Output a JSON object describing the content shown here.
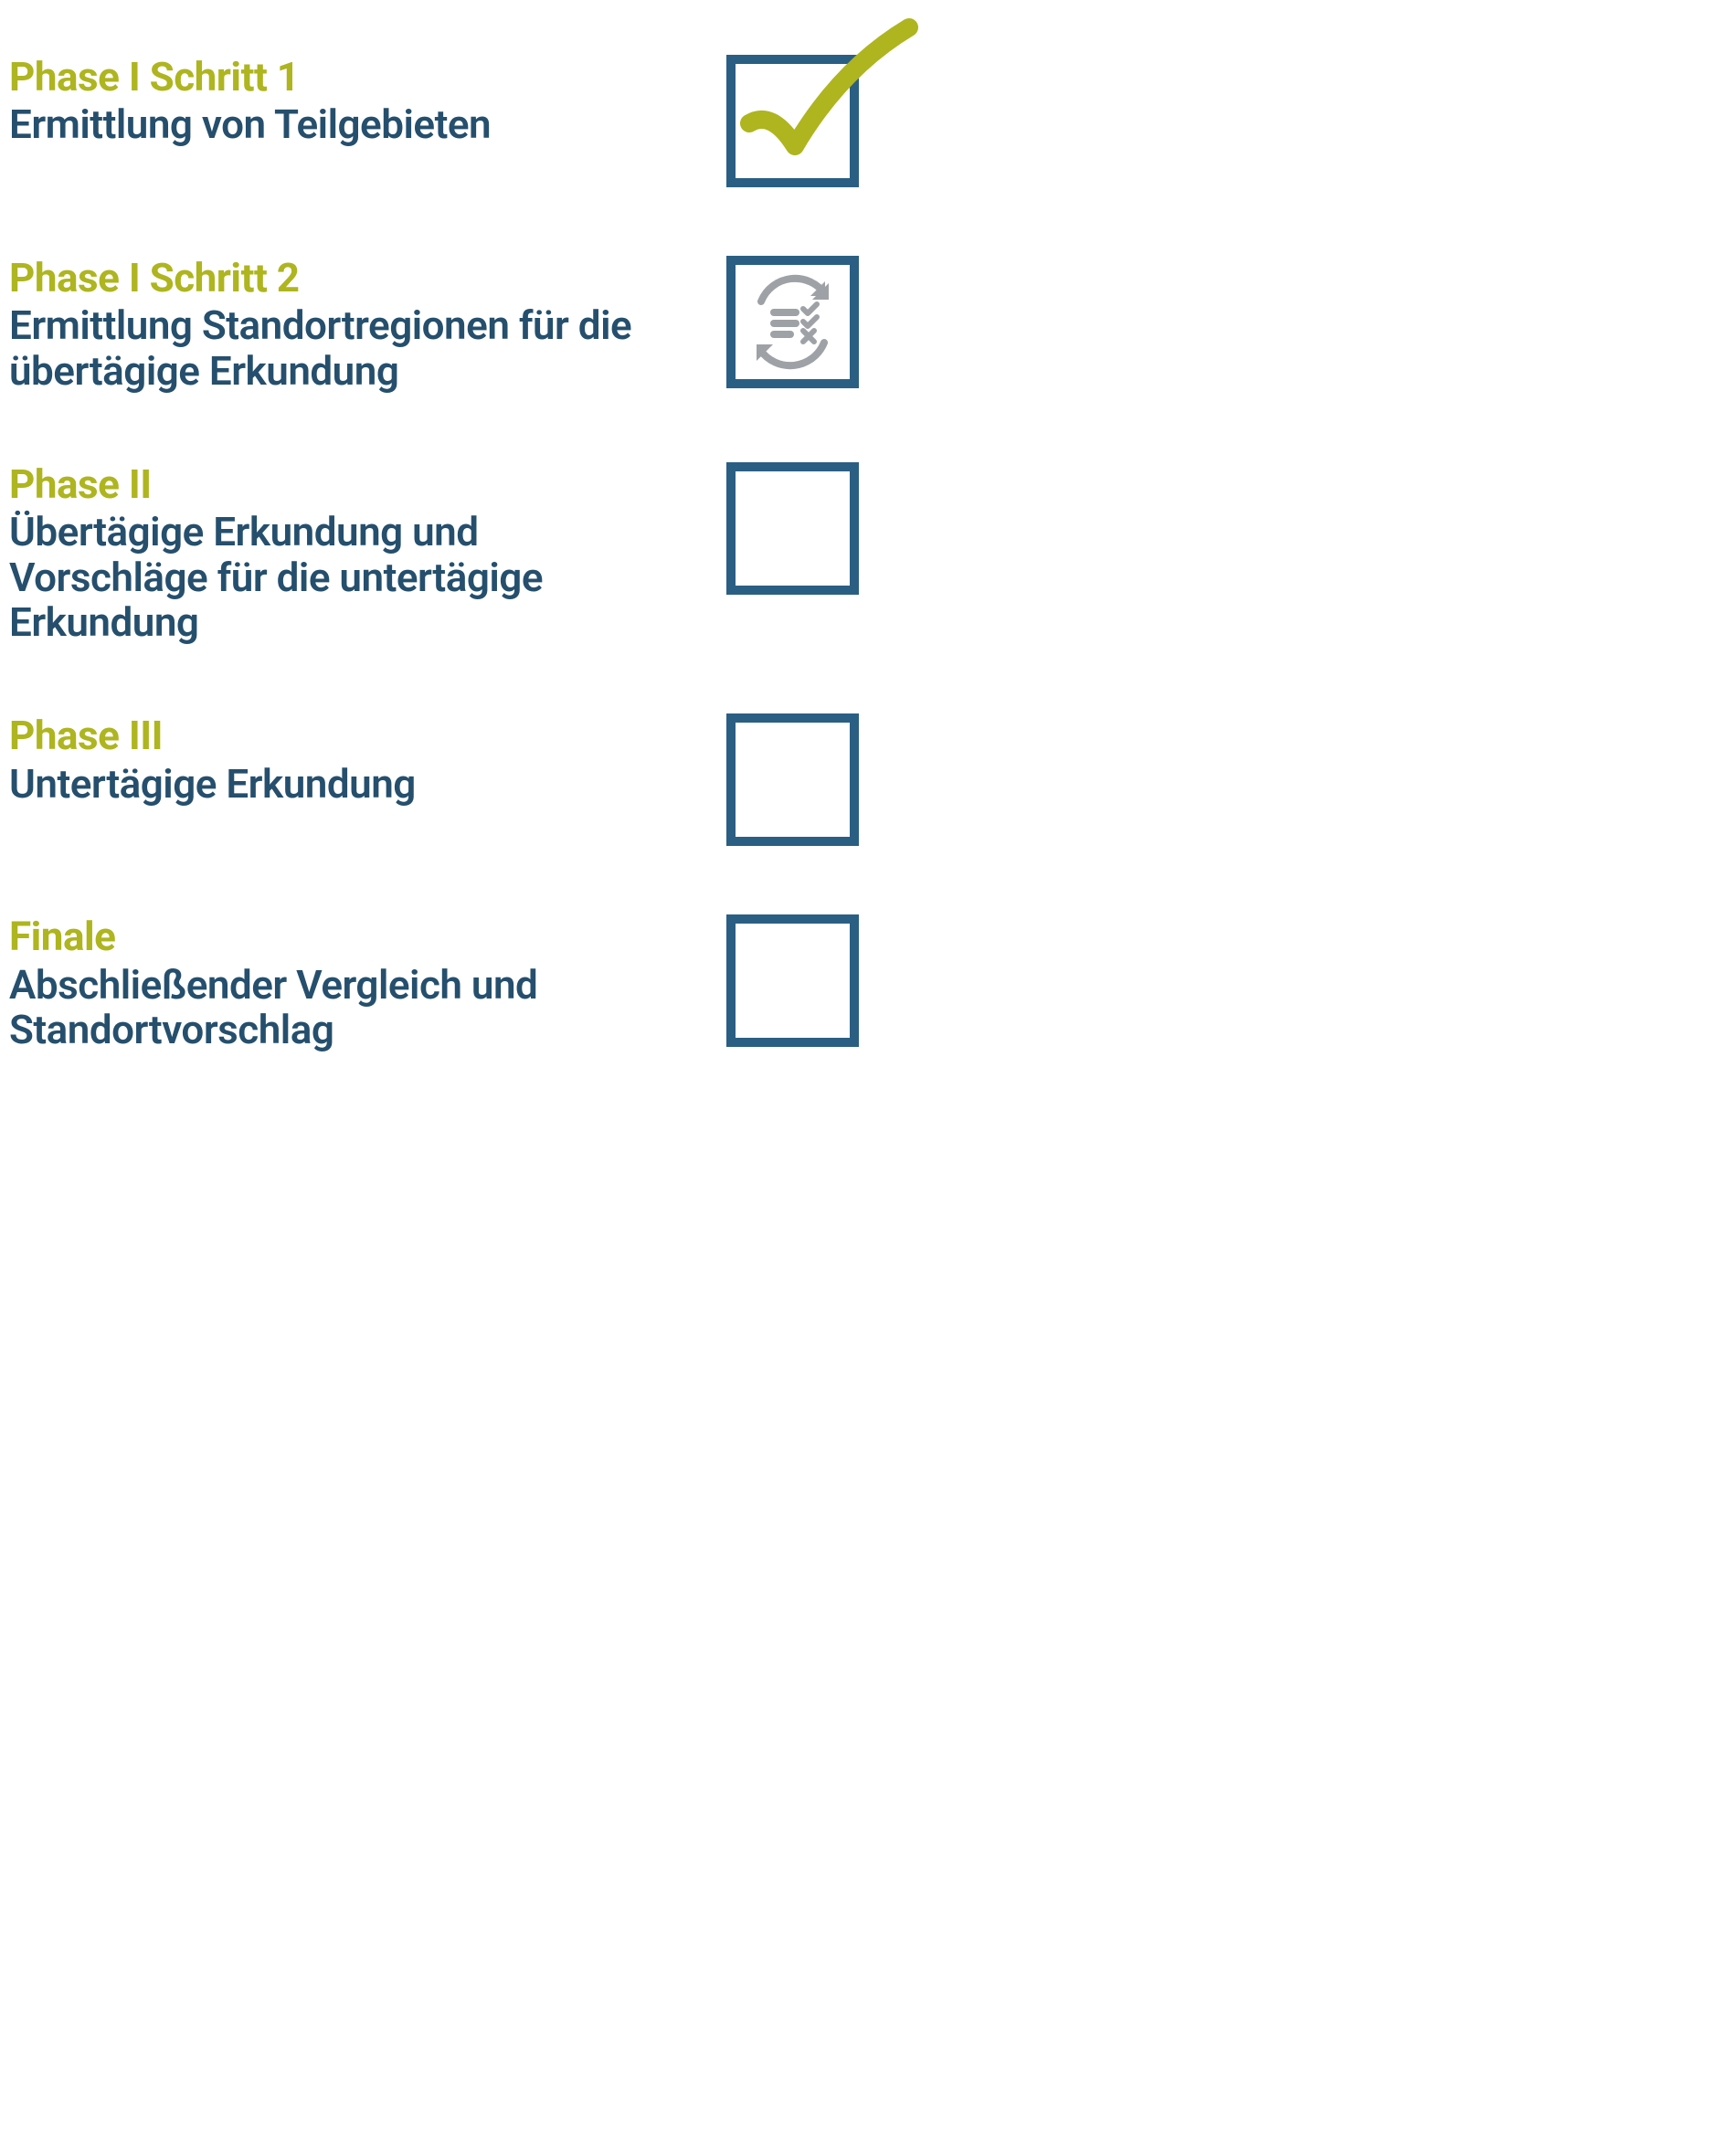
{
  "colors": {
    "accent_olive": "#aeb51f",
    "text_blue": "#254f6d",
    "box_blue": "#2a5f83",
    "icon_grey": "#9ea2a6"
  },
  "phases": [
    {
      "label": "Phase I Schritt 1",
      "description": "Ermittlung von Teilgebieten",
      "status": "done"
    },
    {
      "label": "Phase I Schritt 2",
      "description": "Ermittlung Standortregionen für die übertägige Erkundung",
      "status": "in_progress"
    },
    {
      "label": "Phase II",
      "description": "Übertägige Erkundung und Vorschläge für die untertägige Erkundung",
      "status": "pending"
    },
    {
      "label": "Phase III",
      "description": "Untertägige Erkundung",
      "status": "pending"
    },
    {
      "label": "Finale",
      "description": "Abschließender Vergleich und Standortvorschlag",
      "status": "pending"
    }
  ]
}
